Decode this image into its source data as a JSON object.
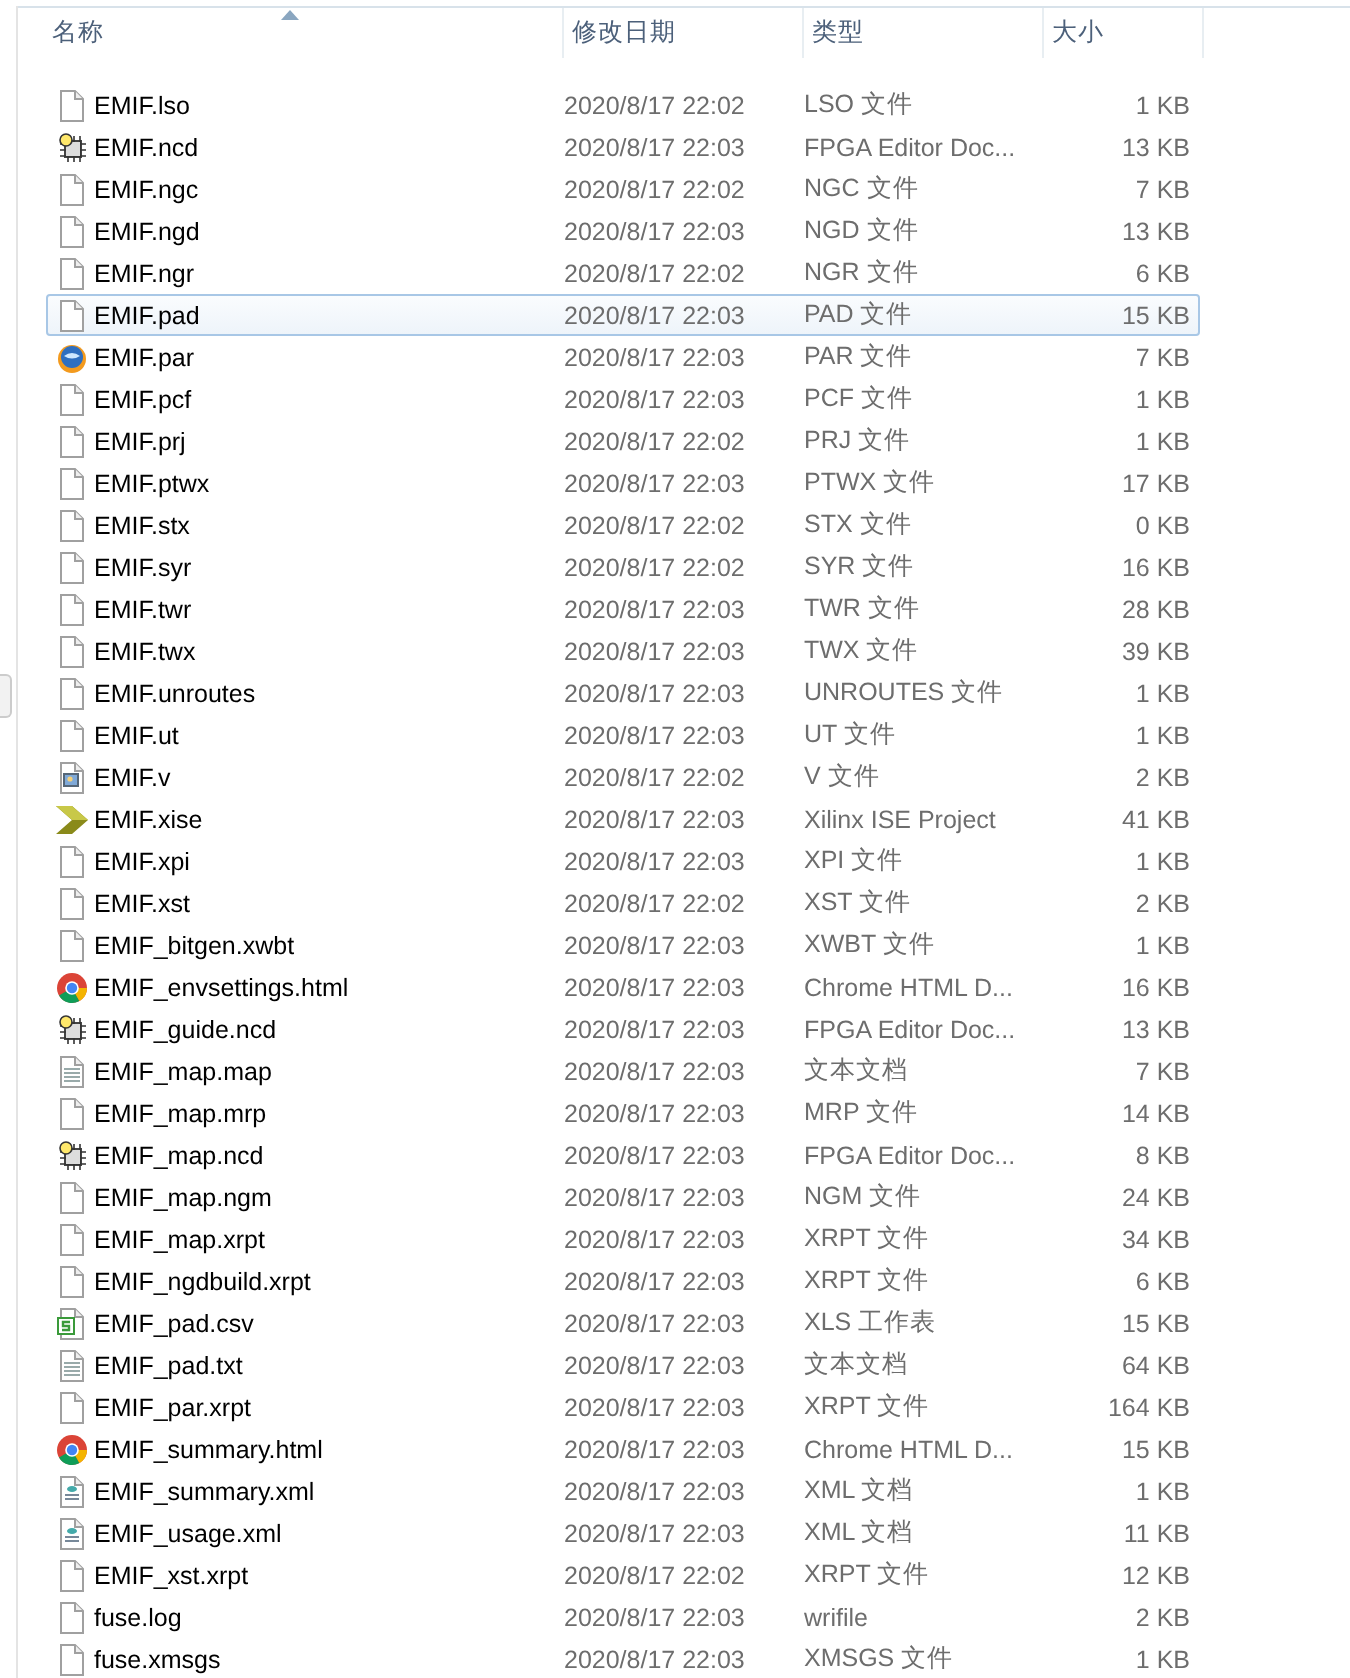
{
  "columns": [
    {
      "label": "名称",
      "sorted": true
    },
    {
      "label": "修改日期",
      "sorted": false
    },
    {
      "label": "类型",
      "sorted": false
    },
    {
      "label": "大小",
      "sorted": false
    }
  ],
  "rows": [
    {
      "name": "EMIF.lso",
      "date": "2020/8/17 22:02",
      "type": "LSO 文件",
      "size": "1 KB",
      "kind": "blank",
      "selected": false
    },
    {
      "name": "EMIF.ncd",
      "date": "2020/8/17 22:03",
      "type": "FPGA Editor Doc...",
      "size": "13 KB",
      "kind": "chip",
      "selected": false
    },
    {
      "name": "EMIF.ngc",
      "date": "2020/8/17 22:02",
      "type": "NGC 文件",
      "size": "7 KB",
      "kind": "blank",
      "selected": false
    },
    {
      "name": "EMIF.ngd",
      "date": "2020/8/17 22:03",
      "type": "NGD 文件",
      "size": "13 KB",
      "kind": "blank",
      "selected": false
    },
    {
      "name": "EMIF.ngr",
      "date": "2020/8/17 22:02",
      "type": "NGR 文件",
      "size": "6 KB",
      "kind": "blank",
      "selected": false
    },
    {
      "name": "EMIF.pad",
      "date": "2020/8/17 22:03",
      "type": "PAD 文件",
      "size": "15 KB",
      "kind": "blank",
      "selected": true
    },
    {
      "name": "EMIF.par",
      "date": "2020/8/17 22:03",
      "type": "PAR 文件",
      "size": "7 KB",
      "kind": "globe",
      "selected": false
    },
    {
      "name": "EMIF.pcf",
      "date": "2020/8/17 22:03",
      "type": "PCF 文件",
      "size": "1 KB",
      "kind": "blank",
      "selected": false
    },
    {
      "name": "EMIF.prj",
      "date": "2020/8/17 22:02",
      "type": "PRJ 文件",
      "size": "1 KB",
      "kind": "blank",
      "selected": false
    },
    {
      "name": "EMIF.ptwx",
      "date": "2020/8/17 22:03",
      "type": "PTWX 文件",
      "size": "17 KB",
      "kind": "blank",
      "selected": false
    },
    {
      "name": "EMIF.stx",
      "date": "2020/8/17 22:02",
      "type": "STX 文件",
      "size": "0 KB",
      "kind": "blank",
      "selected": false
    },
    {
      "name": "EMIF.syr",
      "date": "2020/8/17 22:02",
      "type": "SYR 文件",
      "size": "16 KB",
      "kind": "blank",
      "selected": false
    },
    {
      "name": "EMIF.twr",
      "date": "2020/8/17 22:03",
      "type": "TWR 文件",
      "size": "28 KB",
      "kind": "blank",
      "selected": false
    },
    {
      "name": "EMIF.twx",
      "date": "2020/8/17 22:03",
      "type": "TWX 文件",
      "size": "39 KB",
      "kind": "blank",
      "selected": false
    },
    {
      "name": "EMIF.unroutes",
      "date": "2020/8/17 22:03",
      "type": "UNROUTES 文件",
      "size": "1 KB",
      "kind": "blank",
      "selected": false
    },
    {
      "name": "EMIF.ut",
      "date": "2020/8/17 22:03",
      "type": "UT 文件",
      "size": "1 KB",
      "kind": "blank",
      "selected": false
    },
    {
      "name": "EMIF.v",
      "date": "2020/8/17 22:02",
      "type": "V 文件",
      "size": "2 KB",
      "kind": "image",
      "selected": false
    },
    {
      "name": "EMIF.xise",
      "date": "2020/8/17 22:03",
      "type": "Xilinx ISE Project",
      "size": "41 KB",
      "kind": "chevron",
      "selected": false
    },
    {
      "name": "EMIF.xpi",
      "date": "2020/8/17 22:03",
      "type": "XPI 文件",
      "size": "1 KB",
      "kind": "blank",
      "selected": false
    },
    {
      "name": "EMIF.xst",
      "date": "2020/8/17 22:02",
      "type": "XST 文件",
      "size": "2 KB",
      "kind": "blank",
      "selected": false
    },
    {
      "name": "EMIF_bitgen.xwbt",
      "date": "2020/8/17 22:03",
      "type": "XWBT 文件",
      "size": "1 KB",
      "kind": "blank",
      "selected": false
    },
    {
      "name": "EMIF_envsettings.html",
      "date": "2020/8/17 22:03",
      "type": "Chrome HTML D...",
      "size": "16 KB",
      "kind": "browser",
      "selected": false
    },
    {
      "name": "EMIF_guide.ncd",
      "date": "2020/8/17 22:03",
      "type": "FPGA Editor Doc...",
      "size": "13 KB",
      "kind": "chip",
      "selected": false
    },
    {
      "name": "EMIF_map.map",
      "date": "2020/8/17 22:03",
      "type": "文本文档",
      "size": "7 KB",
      "kind": "text",
      "selected": false
    },
    {
      "name": "EMIF_map.mrp",
      "date": "2020/8/17 22:03",
      "type": "MRP 文件",
      "size": "14 KB",
      "kind": "blank",
      "selected": false
    },
    {
      "name": "EMIF_map.ncd",
      "date": "2020/8/17 22:03",
      "type": "FPGA Editor Doc...",
      "size": "8 KB",
      "kind": "chip",
      "selected": false
    },
    {
      "name": "EMIF_map.ngm",
      "date": "2020/8/17 22:03",
      "type": "NGM 文件",
      "size": "24 KB",
      "kind": "blank",
      "selected": false
    },
    {
      "name": "EMIF_map.xrpt",
      "date": "2020/8/17 22:03",
      "type": "XRPT 文件",
      "size": "34 KB",
      "kind": "blank",
      "selected": false
    },
    {
      "name": "EMIF_ngdbuild.xrpt",
      "date": "2020/8/17 22:03",
      "type": "XRPT 文件",
      "size": "6 KB",
      "kind": "blank",
      "selected": false
    },
    {
      "name": "EMIF_pad.csv",
      "date": "2020/8/17 22:03",
      "type": "XLS 工作表",
      "size": "15 KB",
      "kind": "sheet",
      "selected": false
    },
    {
      "name": "EMIF_pad.txt",
      "date": "2020/8/17 22:03",
      "type": "文本文档",
      "size": "64 KB",
      "kind": "text",
      "selected": false
    },
    {
      "name": "EMIF_par.xrpt",
      "date": "2020/8/17 22:03",
      "type": "XRPT 文件",
      "size": "164 KB",
      "kind": "blank",
      "selected": false
    },
    {
      "name": "EMIF_summary.html",
      "date": "2020/8/17 22:03",
      "type": "Chrome HTML D...",
      "size": "15 KB",
      "kind": "browser",
      "selected": false
    },
    {
      "name": "EMIF_summary.xml",
      "date": "2020/8/17 22:03",
      "type": "XML 文档",
      "size": "1 KB",
      "kind": "xml",
      "selected": false
    },
    {
      "name": "EMIF_usage.xml",
      "date": "2020/8/17 22:03",
      "type": "XML 文档",
      "size": "11 KB",
      "kind": "xml",
      "selected": false
    },
    {
      "name": "EMIF_xst.xrpt",
      "date": "2020/8/17 22:02",
      "type": "XRPT 文件",
      "size": "12 KB",
      "kind": "blank",
      "selected": false
    },
    {
      "name": "fuse.log",
      "date": "2020/8/17 22:03",
      "type": "wrifile",
      "size": "2 KB",
      "kind": "blank",
      "selected": false
    },
    {
      "name": "fuse.xmsgs",
      "date": "2020/8/17 22:03",
      "type": "XMSGS 文件",
      "size": "1 KB",
      "kind": "blank",
      "selected": false
    }
  ]
}
